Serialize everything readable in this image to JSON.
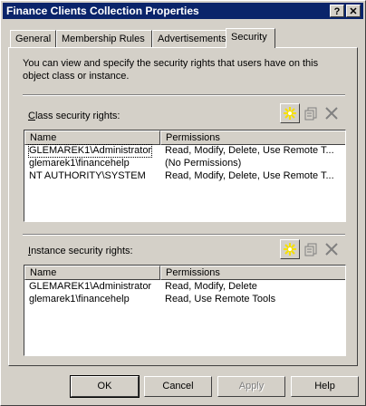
{
  "window": {
    "title": "Finance Clients Collection Properties",
    "help_glyph": "?",
    "close_glyph": "✕"
  },
  "tabs": [
    {
      "label": "General"
    },
    {
      "label": "Membership Rules"
    },
    {
      "label": "Advertisements"
    },
    {
      "label": "Security",
      "active": true
    }
  ],
  "description": "You can view and specify the security rights that users have on this object class or instance.",
  "class_section": {
    "label_prefix": "C",
    "label_rest": "lass security rights:",
    "columns": [
      "Name",
      "Permissions"
    ],
    "rows": [
      {
        "name": "GLEMAREK1\\Administrator",
        "permissions": "Read, Modify, Delete, Use Remote T..."
      },
      {
        "name": "glemarek1\\financehelp",
        "permissions": "(No Permissions)"
      },
      {
        "name": "NT AUTHORITY\\SYSTEM",
        "permissions": "Read, Modify, Delete, Use Remote T..."
      }
    ]
  },
  "instance_section": {
    "label_prefix": "I",
    "label_rest": "nstance security rights:",
    "columns": [
      "Name",
      "Permissions"
    ],
    "rows": [
      {
        "name": "GLEMAREK1\\Administrator",
        "permissions": "Read, Modify, Delete"
      },
      {
        "name": "glemarek1\\financehelp",
        "permissions": "Read, Use Remote Tools"
      }
    ]
  },
  "toolbar_icons": [
    "new-icon",
    "properties-icon",
    "delete-icon"
  ],
  "buttons": {
    "ok": "OK",
    "cancel": "Cancel",
    "apply": "Apply",
    "help": "Help"
  },
  "colors": {
    "titlebar": "#0a246a",
    "face": "#d4d0c8",
    "star": "#f6e000"
  }
}
